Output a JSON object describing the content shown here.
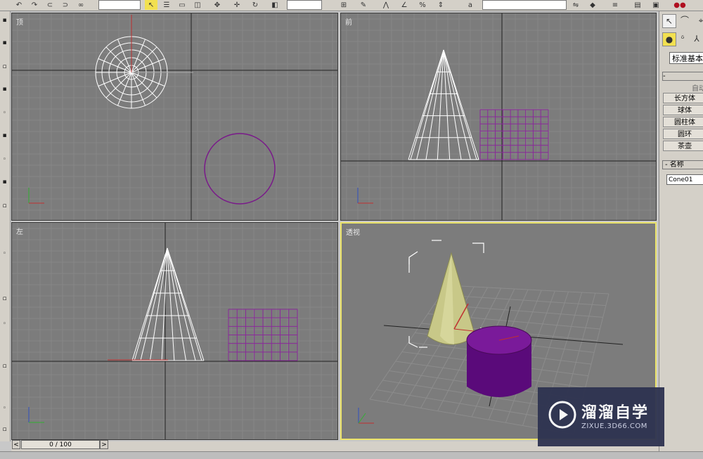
{
  "viewports": {
    "top": {
      "label": "顶"
    },
    "front": {
      "label": "前"
    },
    "left": {
      "label": "左"
    },
    "perspective": {
      "label": "透视"
    }
  },
  "command_panel": {
    "dropdown_value": "标准基本体",
    "object_type_rollout": "-",
    "auto_grid_label": "自动",
    "buttons": [
      "长方体",
      "球体",
      "圆柱体",
      "圆环",
      "茶壶"
    ],
    "name_rollout": "- 名称",
    "name_value": "Cone01"
  },
  "time_slider": {
    "value": "0 / 100",
    "prev": "<",
    "next": ">"
  },
  "watermark": {
    "title": "溜溜自学",
    "url": "ZIXUE.3D66.COM"
  },
  "colors": {
    "viewport_bg": "#7c7c7c",
    "grid_line": "#8a8a8a",
    "axis_line": "#1a1a1a",
    "wire_white": "#ffffff",
    "wire_purple": "#7a1a8a",
    "cone_fill": "#c9c98a",
    "cylinder_fill": "#6a0a8a",
    "active_border": "#ece46a"
  },
  "icons": {
    "select": "arrow-cursor-icon",
    "move": "move-icon",
    "rotate": "rotate-icon",
    "scale": "scale-icon",
    "create_tab": "create-icon",
    "modify_tab": "modify-icon",
    "hierarchy_tab": "hierarchy-icon"
  }
}
